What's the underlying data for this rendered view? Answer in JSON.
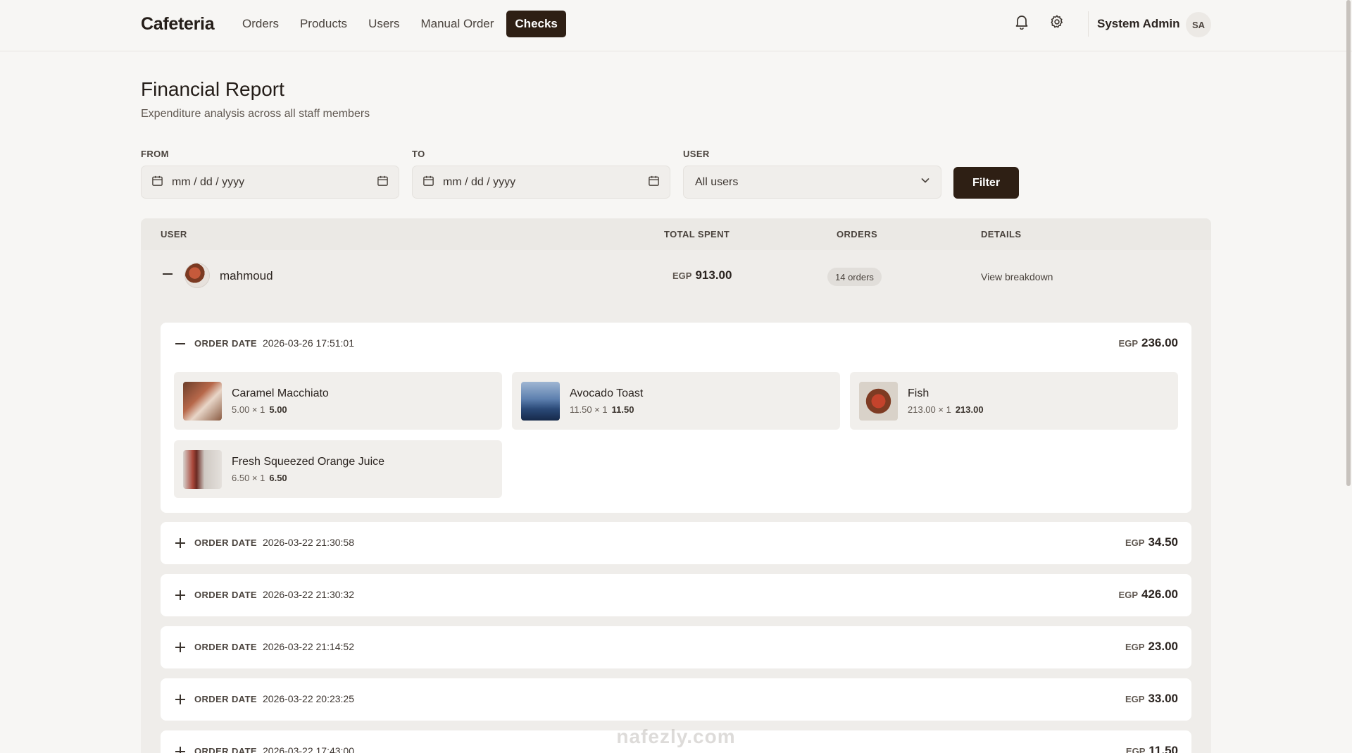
{
  "header": {
    "brand": "Cafeteria",
    "nav": [
      {
        "label": "Orders",
        "active": false
      },
      {
        "label": "Products",
        "active": false
      },
      {
        "label": "Users",
        "active": false
      },
      {
        "label": "Manual Order",
        "active": false
      },
      {
        "label": "Checks",
        "active": true
      }
    ],
    "icons": [
      "bell-icon",
      "gear-icon"
    ],
    "user_name": "System Admin",
    "user_initials": "SA"
  },
  "page": {
    "title": "Financial Report",
    "subtitle": "Expenditure analysis across all staff members"
  },
  "filters": {
    "from_label": "FROM",
    "from_placeholder": "mm / dd / yyyy",
    "to_label": "TO",
    "to_placeholder": "mm / dd / yyyy",
    "user_label": "USER",
    "user_value": "All users",
    "filter_button": "Filter"
  },
  "table": {
    "columns": [
      "USER",
      "TOTAL SPENT",
      "ORDERS",
      "DETAILS"
    ],
    "row": {
      "user": "mahmoud",
      "currency": "EGP",
      "total": "913.00",
      "orders": "14 orders",
      "details": "View breakdown"
    }
  },
  "orders": [
    {
      "label": "ORDER DATE",
      "date": "2026-03-26 17:51:01",
      "currency": "EGP",
      "amount": "236.00",
      "expanded": true,
      "items": [
        {
          "name": "Caramel Macchiato",
          "qty": "5.00 × 1",
          "subtotal": "5.00"
        },
        {
          "name": "Avocado Toast",
          "qty": "11.50 × 1",
          "subtotal": "11.50"
        },
        {
          "name": "Fish",
          "qty": "213.00 × 1",
          "subtotal": "213.00"
        },
        {
          "name": "Fresh Squeezed Orange Juice",
          "qty": "6.50 × 1",
          "subtotal": "6.50"
        }
      ]
    },
    {
      "label": "ORDER DATE",
      "date": "2026-03-22 21:30:58",
      "currency": "EGP",
      "amount": "34.50",
      "expanded": false
    },
    {
      "label": "ORDER DATE",
      "date": "2026-03-22 21:30:32",
      "currency": "EGP",
      "amount": "426.00",
      "expanded": false
    },
    {
      "label": "ORDER DATE",
      "date": "2026-03-22 21:14:52",
      "currency": "EGP",
      "amount": "23.00",
      "expanded": false
    },
    {
      "label": "ORDER DATE",
      "date": "2026-03-22 20:23:25",
      "currency": "EGP",
      "amount": "33.00",
      "expanded": false
    },
    {
      "label": "ORDER DATE",
      "date": "2026-03-22 17:43:00",
      "currency": "EGP",
      "amount": "11.50",
      "expanded": false
    }
  ],
  "watermark": "nafezly.com",
  "colors": {
    "accent": "#2e1f14",
    "background": "#f7f6f4",
    "card": "#ffffff"
  }
}
